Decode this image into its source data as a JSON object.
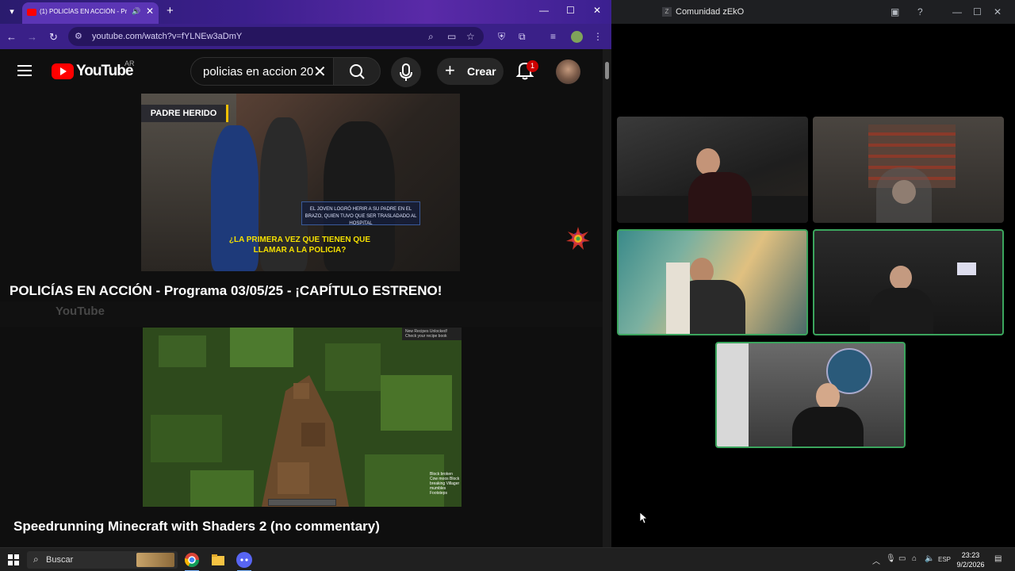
{
  "browser": {
    "tab_title": "(1) POLICÍAS EN ACCIÓN - Pr",
    "url": "youtube.com/watch?v=fYLNEw3aDmY",
    "colors": {
      "tabbar": "#3b1f8c",
      "accent": "#ff0000"
    }
  },
  "youtube": {
    "logo_text": "YouTube",
    "country": "AR",
    "search_value": "policias en accion 20",
    "create_label": "Crear",
    "notification_count": "1"
  },
  "video1": {
    "overlay_label": "PADRE HERIDO",
    "info_box": "EL JOVEN LOGRÓ HERIR A SU PADRE EN EL BRAZO, QUIEN TUVO QUE SER TRASLADADO AL HOSPITAL",
    "subtitle": "¿LA PRIMERA VEZ QUE TIENEN QUE LLAMAR A LA POLICIA?",
    "title": "POLICÍAS EN ACCIÓN - Programa 03/05/25 - ¡CAPÍTULO ESTRENO!"
  },
  "video2": {
    "toast": "New Recipes Unlocked! Check your recipe book",
    "hud_text": "Block broken Cow moos Block breaking Villager mumbles Footsteps",
    "title": "Speedrunning Minecraft with Shaders 2 (no commentary)"
  },
  "discord": {
    "window_title": "Comunidad zEkO",
    "speaking_color": "#3ba55d"
  },
  "taskbar": {
    "search_label": "Buscar",
    "lang": "ESP",
    "time": "23:23",
    "date": "9/2/2026"
  }
}
